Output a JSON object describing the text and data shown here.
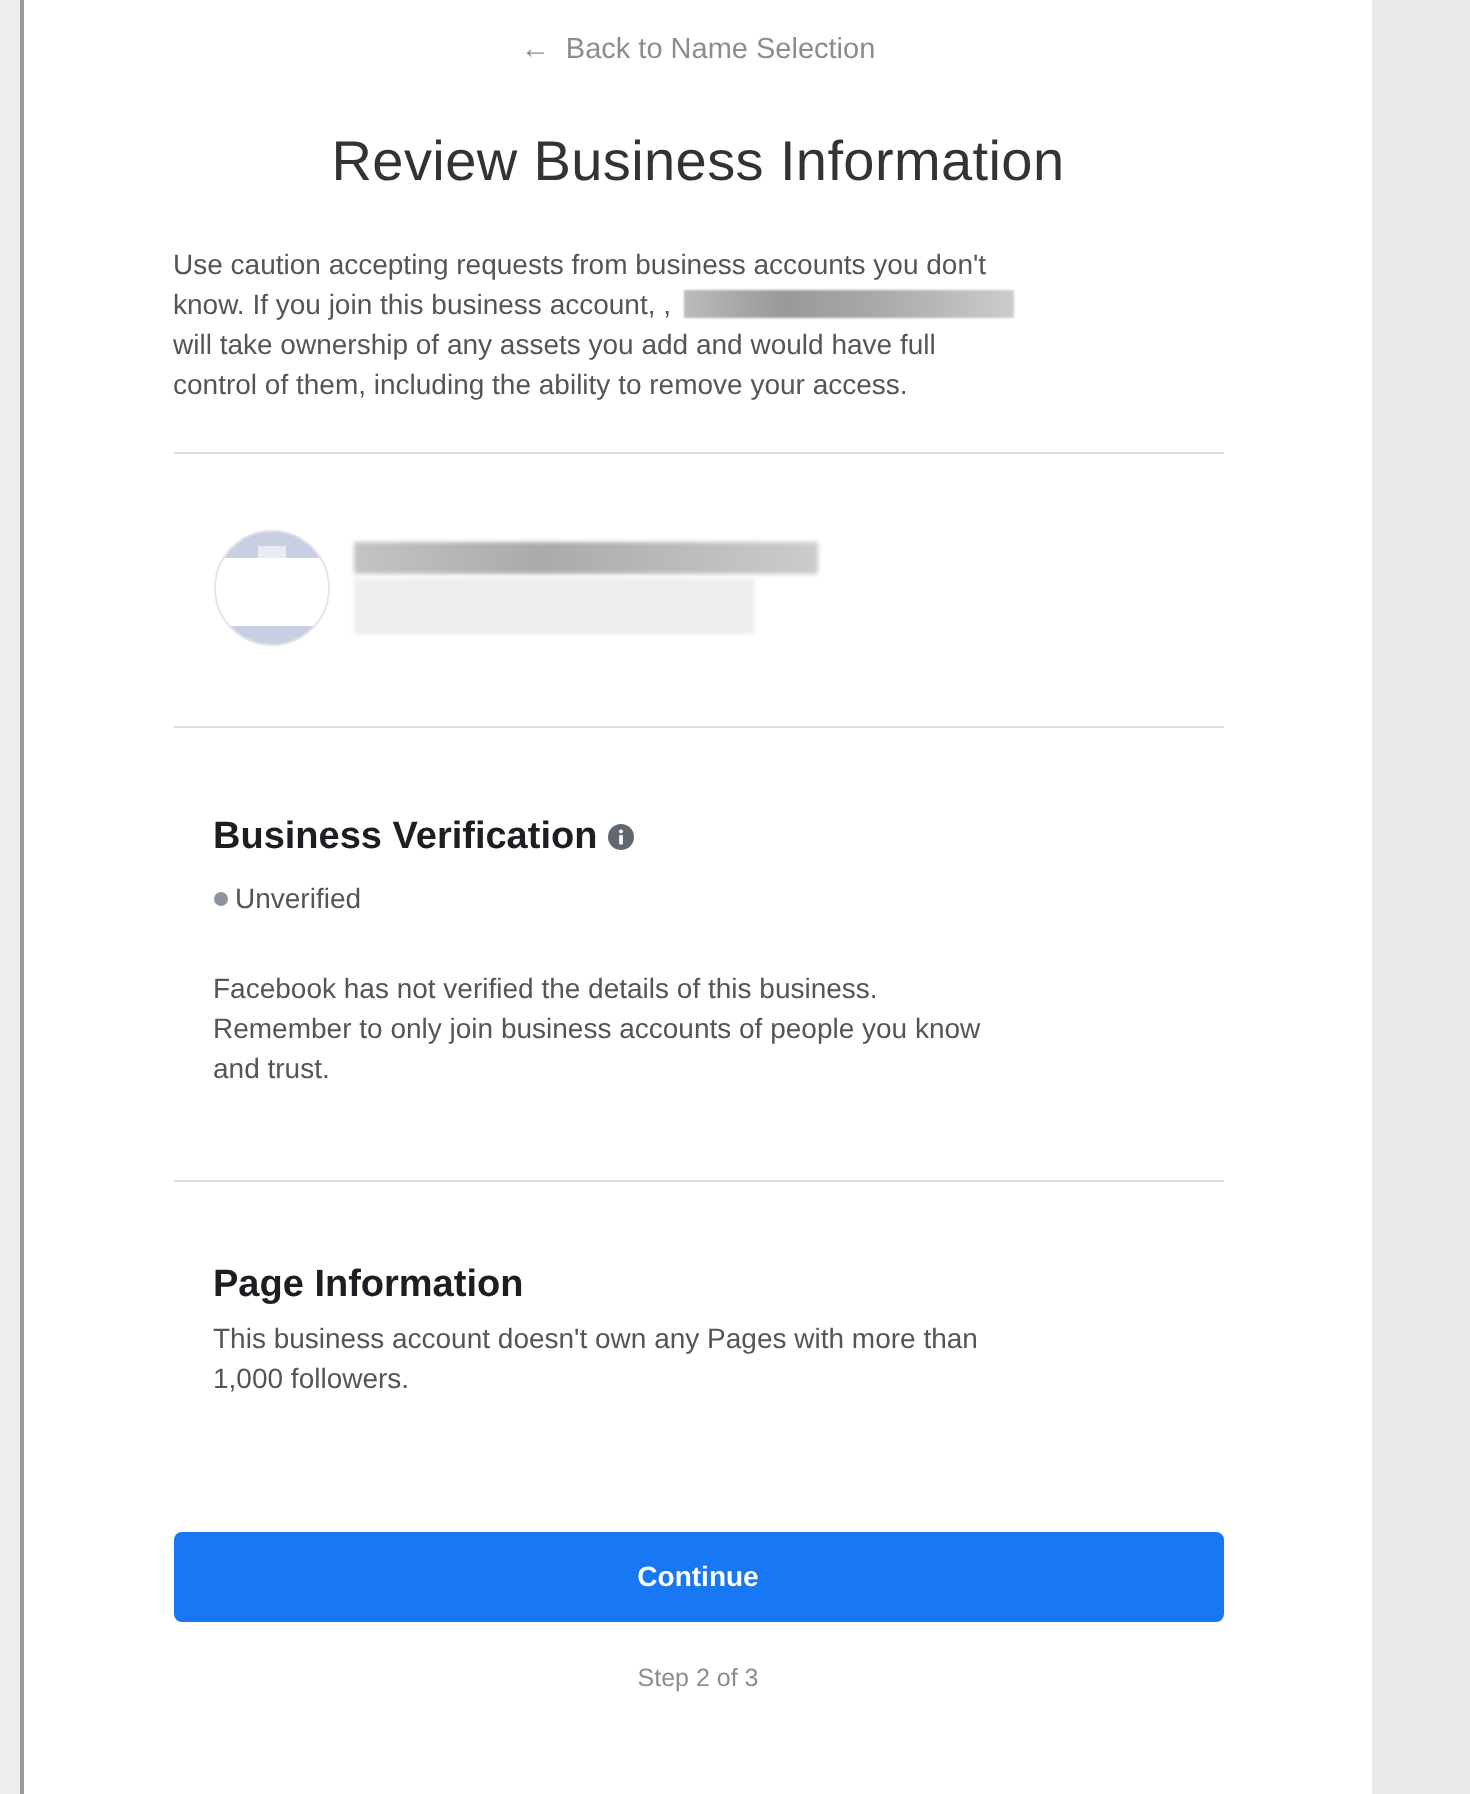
{
  "back_link": {
    "arrow": "←",
    "label": "Back to Name Selection"
  },
  "title": "Review Business Information",
  "warning": {
    "lines_before": [
      "Use caution accepting requests from business accounts you don't",
      "know. If you join this business account, ,"
    ],
    "lines_after": [
      "will take ownership of any assets you add and would have full",
      "control of them, including the ability to remove your access."
    ]
  },
  "verification": {
    "heading": "Business Verification",
    "status": "Unverified",
    "description": "Facebook has not verified the details of this business. Remember to only join business accounts of people you know and trust."
  },
  "page_info": {
    "heading": "Page Information",
    "description": "This business account doesn't own any Pages with more than 1,000 followers."
  },
  "continue_button": "Continue",
  "step": "Step 2 of 3"
}
